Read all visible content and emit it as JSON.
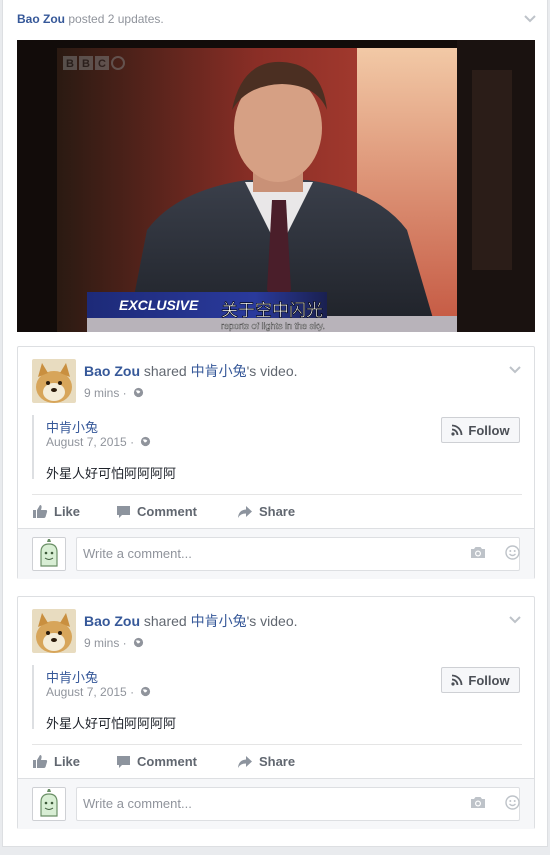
{
  "header": {
    "name": "Bao Zou",
    "text": "posted 2 updates."
  },
  "video": {
    "channel_logo": "BBC",
    "banner": "EXCLUSIVE",
    "subtitle_cn": "关于空中闪光",
    "subtitle_en": "reports of lights in the sky."
  },
  "posts": [
    {
      "author": "Bao Zou",
      "verb": "shared",
      "page": "中肯小兔",
      "object": "'s video.",
      "time": "9 mins",
      "shared_name": "中肯小兔",
      "shared_date": "August 7, 2015",
      "shared_text": "外星人好可怕阿阿阿阿",
      "follow_label": "Follow",
      "like_label": "Like",
      "comment_label": "Comment",
      "share_label": "Share",
      "comment_placeholder": "Write a comment..."
    },
    {
      "author": "Bao Zou",
      "verb": "shared",
      "page": "中肯小兔",
      "object": "'s video.",
      "time": "9 mins",
      "shared_name": "中肯小兔",
      "shared_date": "August 7, 2015",
      "shared_text": "外星人好可怕阿阿阿阿",
      "follow_label": "Follow",
      "like_label": "Like",
      "comment_label": "Comment",
      "share_label": "Share",
      "comment_placeholder": "Write a comment..."
    }
  ],
  "colors": {
    "link": "#365899",
    "meta": "#90949c",
    "banner": "#1d2a78"
  }
}
